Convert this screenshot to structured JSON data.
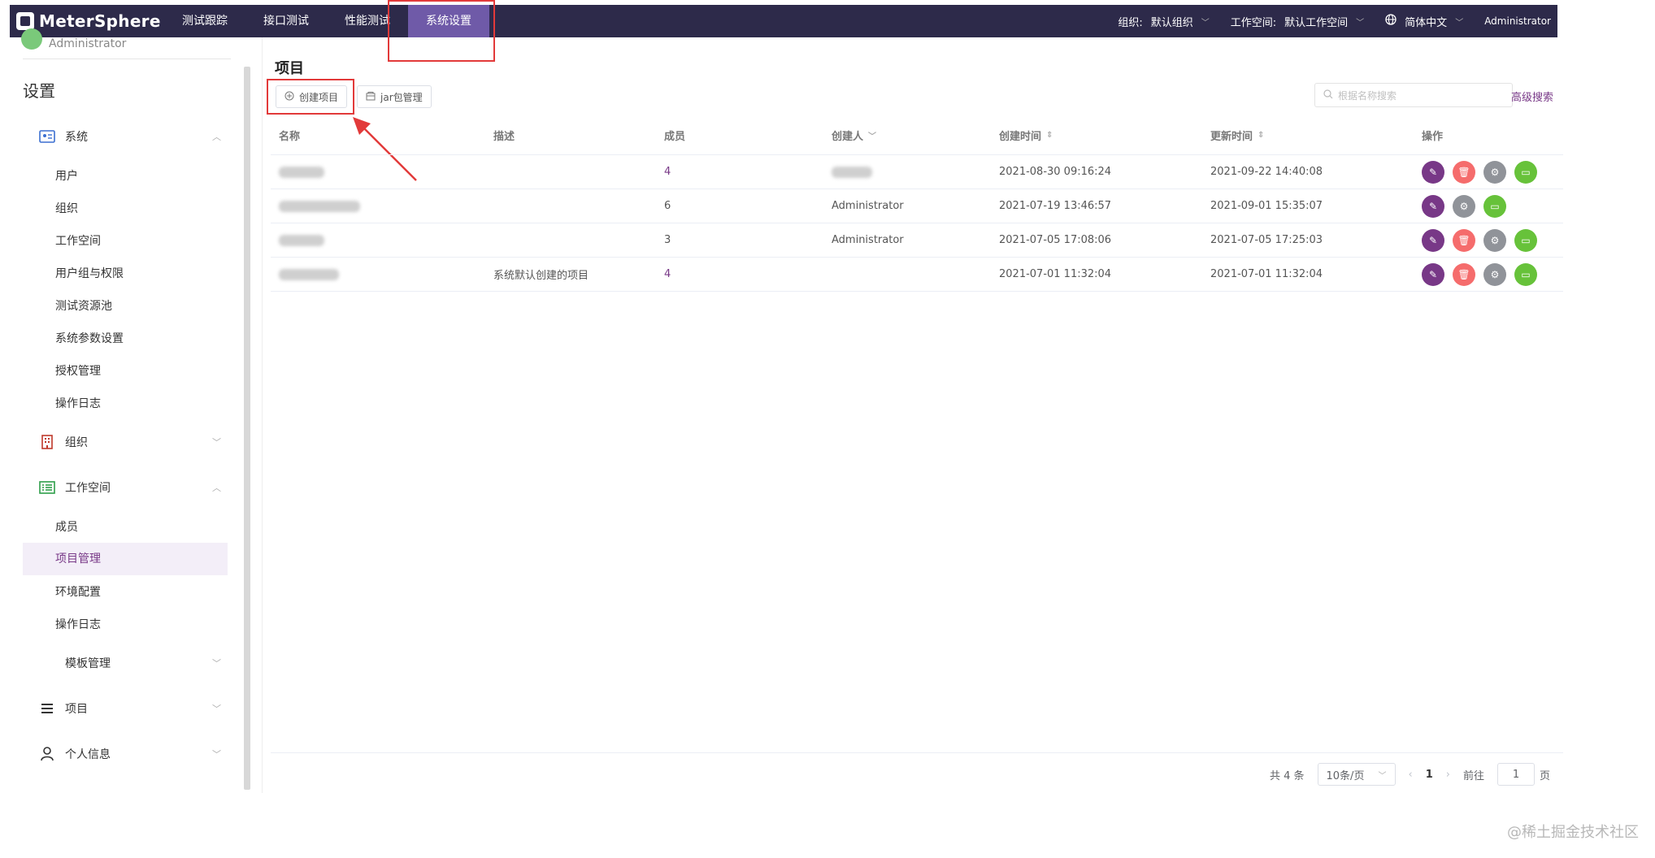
{
  "app": {
    "name": "MeterSphere"
  },
  "nav": {
    "items": [
      {
        "label": "测试跟踪"
      },
      {
        "label": "接口测试"
      },
      {
        "label": "性能测试"
      },
      {
        "label": "系统设置",
        "active": true
      }
    ],
    "org_label": "组织:",
    "org_value": "默认组织",
    "workspace_label": "工作空间:",
    "workspace_value": "默认工作空间",
    "language": "简体中文",
    "user": "Administrator"
  },
  "sidebar": {
    "user_name": "Administrator",
    "title": "设置",
    "system_group": "系统",
    "system_items": [
      "用户",
      "组织",
      "工作空间",
      "用户组与权限",
      "测试资源池",
      "系统参数设置",
      "授权管理",
      "操作日志"
    ],
    "org_group": "组织",
    "workspace_group": "工作空间",
    "workspace_items": [
      "成员",
      "项目管理",
      "环境配置",
      "操作日志"
    ],
    "active_item": "项目管理",
    "template_group": "模板管理",
    "project_group": "项目",
    "personal_group": "个人信息"
  },
  "main": {
    "title": "项目",
    "create_button": "创建项目",
    "jar_button": "jar包管理",
    "search_placeholder": "根据名称搜索",
    "advanced_search": "高级搜索",
    "columns": {
      "name": "名称",
      "description": "描述",
      "members": "成员",
      "creator": "创建人",
      "create_time": "创建时间",
      "update_time": "更新时间",
      "actions": "操作"
    },
    "rows": [
      {
        "description": "",
        "members": "4",
        "creator": "",
        "create_time": "2021-08-30 09:16:24",
        "update_time": "2021-09-22 14:40:08"
      },
      {
        "description": "",
        "members": "6",
        "creator": "Administrator",
        "create_time": "2021-07-19 13:46:57",
        "update_time": "2021-09-01 15:35:07"
      },
      {
        "description": "",
        "members": "3",
        "creator": "Administrator",
        "create_time": "2021-07-05 17:08:06",
        "update_time": "2021-07-05 17:25:03"
      },
      {
        "description": "系统默认创建的项目",
        "members": "4",
        "creator": "",
        "create_time": "2021-07-01 11:32:04",
        "update_time": "2021-07-01 11:32:04"
      }
    ]
  },
  "pagination": {
    "total": "共 4 条",
    "page_size": "10条/页",
    "current": "1",
    "goto_label": "前往",
    "goto_value": "1",
    "page_suffix": "页"
  },
  "watermark": "@稀土掘金技术社区",
  "colors": {
    "topbar": "#2d2a4a",
    "accent": "#783887",
    "active_nav": "#6f5aa8",
    "annotation": "#e23a3a"
  }
}
